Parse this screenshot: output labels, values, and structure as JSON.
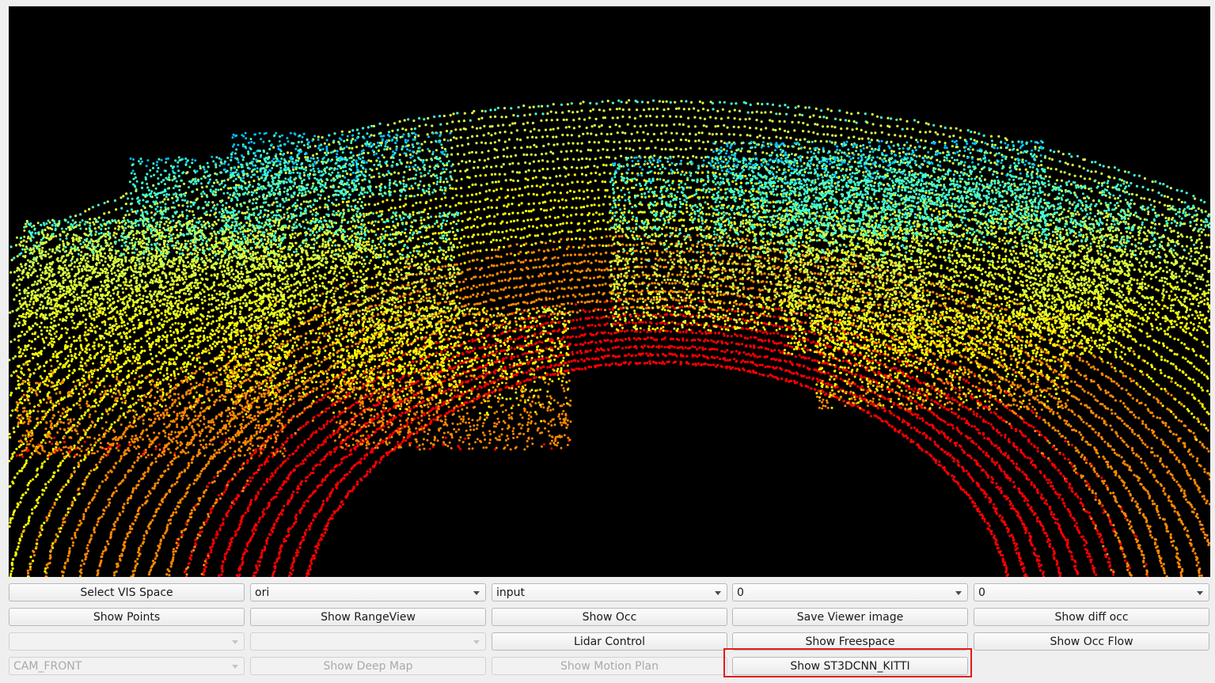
{
  "viewer": {
    "background": "#000000",
    "point_colormap": [
      "#ff0000",
      "#ff8800",
      "#ffff00",
      "#d8ff40",
      "#40ffd0",
      "#00c0ff",
      "#0040ff"
    ]
  },
  "controls": {
    "row1": {
      "select_vis_space_label": "Select VIS Space",
      "space_combo_value": "ori",
      "data_combo_value": "input",
      "index_combo_1_value": "0",
      "index_combo_2_value": "0"
    },
    "row2": {
      "show_points_label": "Show Points",
      "show_rangeview_label": "Show RangeView",
      "show_occ_label": "Show Occ",
      "save_viewer_image_label": "Save Viewer image",
      "show_diff_occ_label": "Show diff occ"
    },
    "row3": {
      "empty_combo_1_value": "",
      "empty_combo_2_value": "",
      "lidar_control_label": "Lidar Control",
      "show_freespace_label": "Show Freespace",
      "show_occ_flow_label": "Show Occ Flow"
    },
    "row4": {
      "camera_combo_value": "CAM_FRONT",
      "show_deep_map_label": "Show Deep Map",
      "show_motion_plan_label": "Show Motion Plan",
      "show_st3dcnn_kitti_label": "Show ST3DCNN_KITTI"
    }
  },
  "highlight_color": "#e41a1a"
}
